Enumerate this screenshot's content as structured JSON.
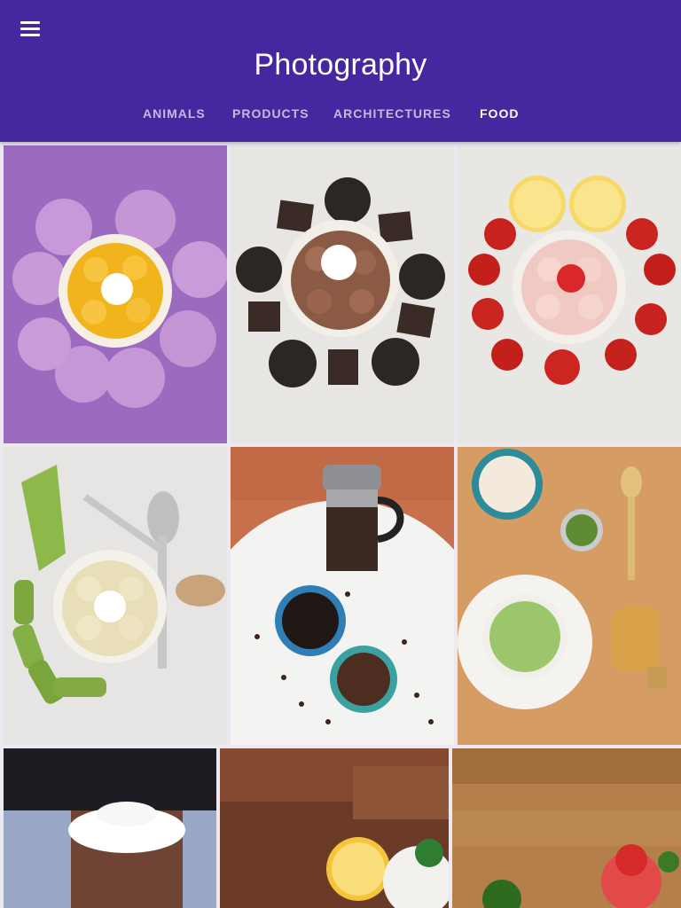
{
  "appbar": {
    "title": "Photography",
    "menu_icon": "hamburger-menu-icon",
    "background": "#4527a0"
  },
  "tabs": [
    {
      "label": "ANIMALS",
      "active": false
    },
    {
      "label": "PRODUCTS",
      "active": false
    },
    {
      "label": "ARCHITECTURES",
      "active": false
    },
    {
      "label": "FOOD",
      "active": true
    }
  ],
  "photos": [
    {
      "subject": "rolled ice cream with mango and purple roses"
    },
    {
      "subject": "chocolate rolled ice cream with cookies and chocolate squares"
    },
    {
      "subject": "strawberry rolled ice cream with lemons and strawberries"
    },
    {
      "subject": "rolled ice cream with celery and spoons"
    },
    {
      "subject": "french press coffee with beans and cups"
    },
    {
      "subject": "matcha latte with whisk and spoon"
    },
    {
      "subject": "chocolate mousse with whipped cream"
    },
    {
      "subject": "lemon shaved ice with mint"
    },
    {
      "subject": "strawberry shaved ice dessert"
    }
  ]
}
